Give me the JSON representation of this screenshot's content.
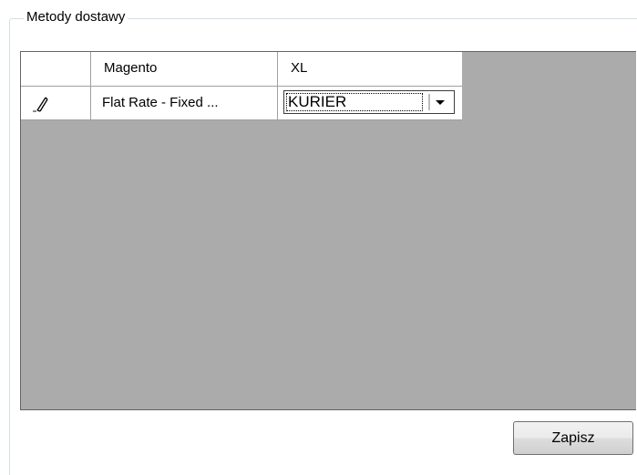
{
  "groupbox": {
    "title": "Metody dostawy"
  },
  "grid": {
    "columns": [
      "",
      "Magento",
      "XL"
    ],
    "rows": [
      {
        "row_icon": "pencil-icon",
        "magento": "Flat Rate - Fixed  ...",
        "xl": "KURIER"
      }
    ]
  },
  "buttons": {
    "save_label": "Zapisz"
  },
  "colors": {
    "grid_background": "#ababab",
    "grid_border": "#646464",
    "cell_background": "#ffffff"
  }
}
